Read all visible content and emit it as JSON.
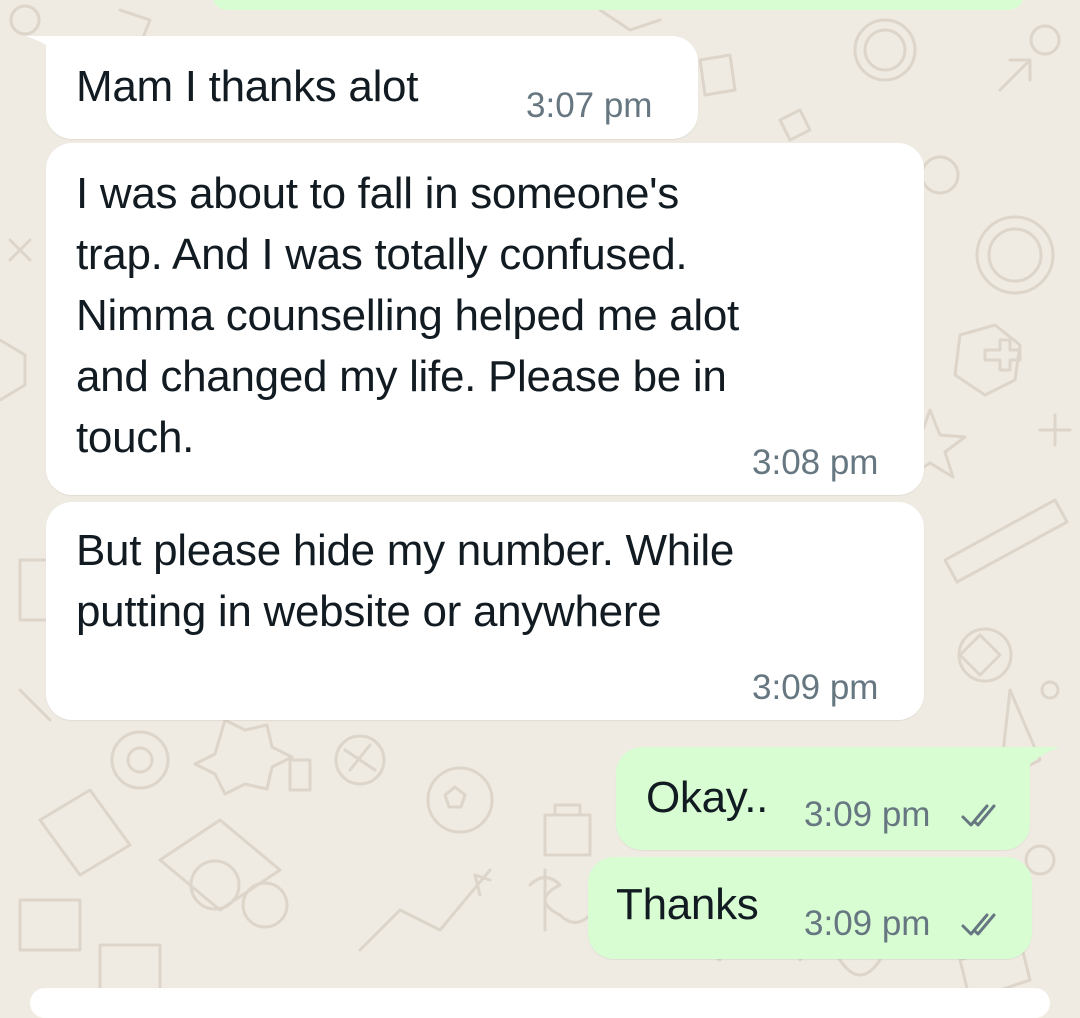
{
  "chat": {
    "colors": {
      "wallpaper": "#efeae2",
      "incoming_bubble": "#ffffff",
      "outgoing_bubble": "#d9fdd3",
      "text": "#111b21",
      "timestamp": "#667781",
      "read_ticks": "#667781"
    },
    "messages": [
      {
        "direction": "incoming",
        "lines": [
          "Mam I thanks alot"
        ],
        "time": "3:07 pm"
      },
      {
        "direction": "incoming",
        "lines": [
          "I was about to fall in someone's",
          "trap. And I was totally confused.",
          "Nimma counselling helped me alot",
          "and changed my life. Please be in",
          "touch."
        ],
        "time": "3:08 pm"
      },
      {
        "direction": "incoming",
        "lines": [
          "But please hide my number. While",
          "putting in website or anywhere"
        ],
        "time": "3:09 pm"
      },
      {
        "direction": "outgoing",
        "lines": [
          "Okay.."
        ],
        "time": "3:09 pm",
        "status_icon": "double-check-icon"
      },
      {
        "direction": "outgoing",
        "lines": [
          "Thanks"
        ],
        "time": "3:09 pm",
        "status_icon": "double-check-icon"
      }
    ]
  }
}
